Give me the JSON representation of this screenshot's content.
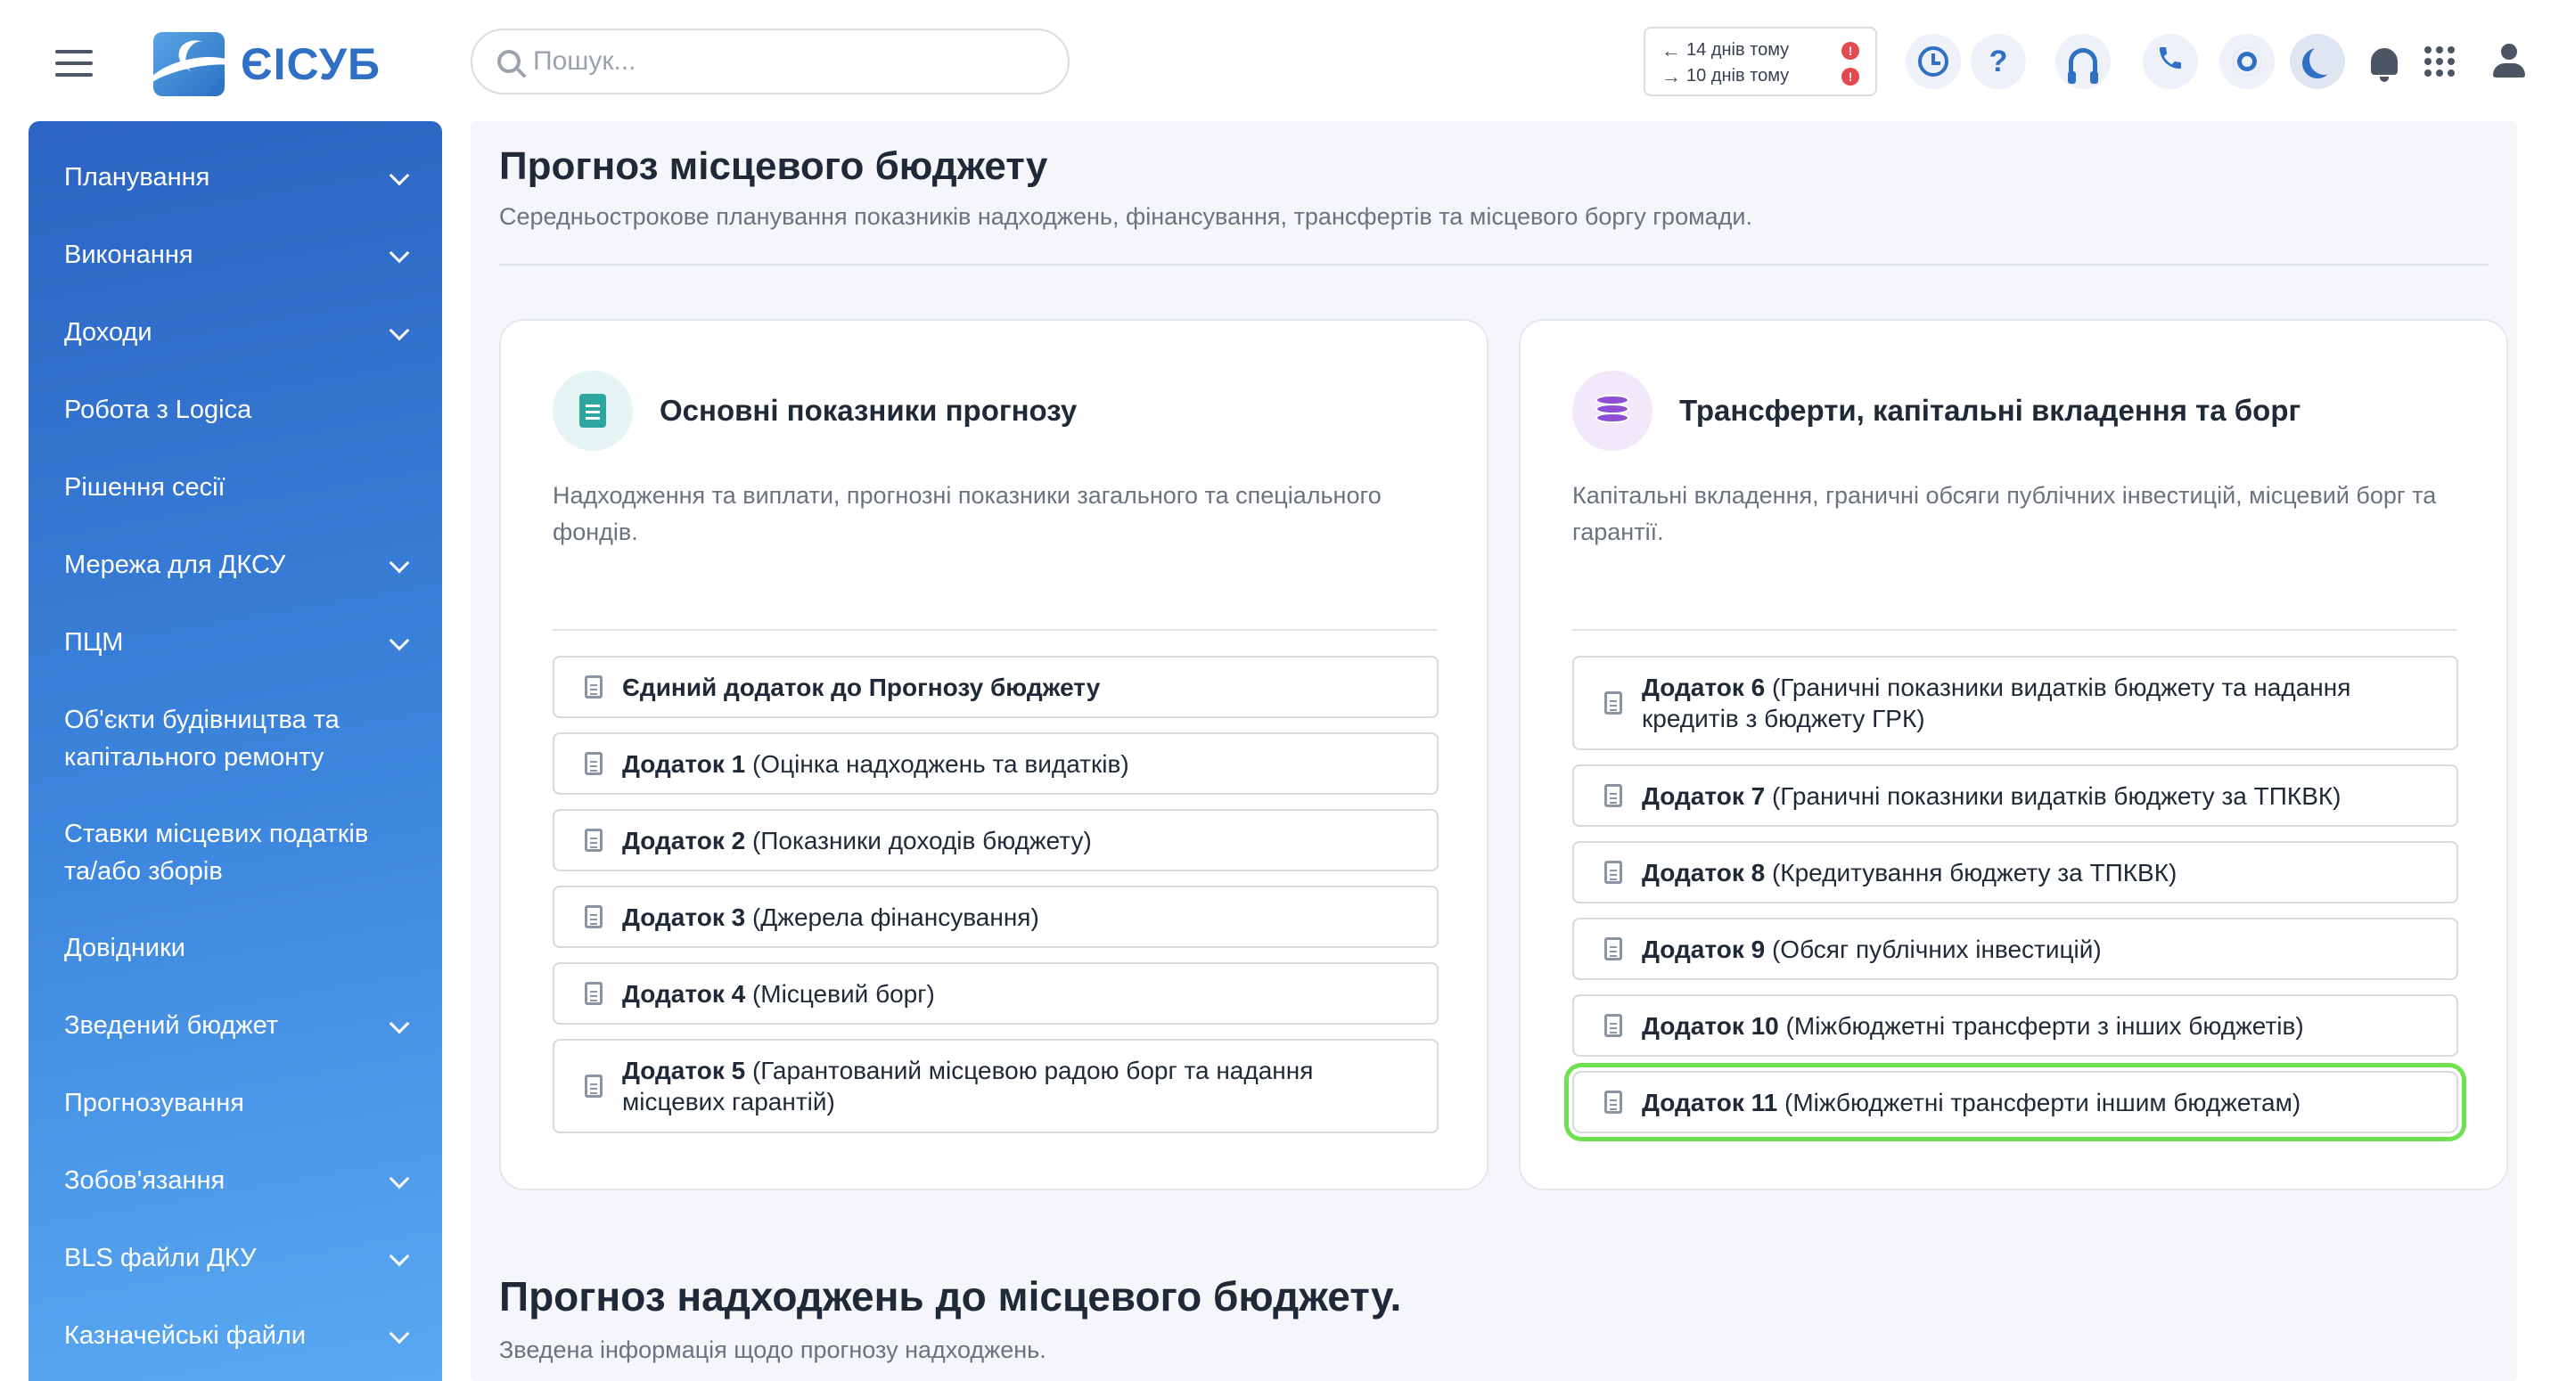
{
  "app": {
    "logo_text": "ЄІСУБ"
  },
  "search": {
    "placeholder": "Пошук..."
  },
  "history": [
    {
      "direction": "back",
      "label": "14 днів тому",
      "badge": "!"
    },
    {
      "direction": "forward",
      "label": "10 днів тому",
      "badge": "!"
    }
  ],
  "toolbar": {
    "help_label": "?",
    "icons": [
      "alarm-clock-icon",
      "help-icon",
      "headset-icon",
      "phone-icon",
      "gear-icon",
      "moon-icon",
      "bell-icon",
      "apps-grid-icon",
      "user-icon"
    ]
  },
  "sidebar": {
    "items": [
      {
        "label": "Планування",
        "expandable": true
      },
      {
        "label": "Виконання",
        "expandable": true
      },
      {
        "label": "Доходи",
        "expandable": true
      },
      {
        "label": "Робота з Logica",
        "expandable": false
      },
      {
        "label": "Рішення сесії",
        "expandable": false
      },
      {
        "label": "Мережа для ДКСУ",
        "expandable": true
      },
      {
        "label": "ПЦМ",
        "expandable": true
      },
      {
        "label": "Об'єкти будівництва та капітального ремонту",
        "expandable": false
      },
      {
        "label": "Ставки місцевих податків та/або зборів",
        "expandable": false
      },
      {
        "label": "Довідники",
        "expandable": false
      },
      {
        "label": "Зведений бюджет",
        "expandable": true
      },
      {
        "label": "Прогнозування",
        "expandable": false
      },
      {
        "label": "Зобов'язання",
        "expandable": true
      },
      {
        "label": "BLS файли ДКУ",
        "expandable": true
      },
      {
        "label": "Казначейські файли",
        "expandable": true
      }
    ]
  },
  "main": {
    "title": "Прогноз місцевого бюджету",
    "subtitle": "Середньострокове планування показників надходжень, фінансування, трансфертів та місцевого боргу громади.",
    "cards": [
      {
        "title": "Основні показники прогнозу",
        "icon": "document-icon",
        "description": "Надходження та виплати, прогнозні показники загального та спеціального фондів.",
        "documents": [
          {
            "label": "Єдиний додаток до Прогнозу бюджету"
          },
          {
            "label": "Додаток 1 (Оцінка надходжень та видатків)"
          },
          {
            "label": "Додаток 2 (Показники доходів бюджету)"
          },
          {
            "label": "Додаток 3 (Джерела фінансування)"
          },
          {
            "label": "Додаток 4 (Місцевий борг)"
          },
          {
            "label": "Додаток 5 (Гарантований місцевою радою борг та надання місцевих гарантій)"
          }
        ]
      },
      {
        "title": "Трансферти, капітальні вкладення та борг",
        "icon": "coins-icon",
        "description": "Капітальні вкладення, граничні обсяги публічних інвестицій, місцевий борг та гарантії.",
        "documents": [
          {
            "label": "Додаток 6 (Граничні показники видатків бюджету та надання кредитів з бюджету ГРК)"
          },
          {
            "label": "Додаток 7 (Граничні показники видатків бюджету за ТПКВК)"
          },
          {
            "label": "Додаток 8 (Кредитування бюджету за ТПКВК)"
          },
          {
            "label": "Додаток 9 (Обсяг публічних інвестицій)"
          },
          {
            "label": "Додаток 10 (Міжбюджетні трансферти з інших бюджетів)"
          },
          {
            "label": "Додаток 11 (Міжбюджетні трансферти іншим бюджетам)",
            "highlighted": true
          }
        ]
      }
    ],
    "section2": {
      "title": "Прогноз надходжень до місцевого бюджету.",
      "subtitle": "Зведена інформація щодо прогнозу надходжень."
    }
  },
  "colors": {
    "accent": "#2f6fc4",
    "highlight": "#6fe04f",
    "sidebar_top": "#2b64c2",
    "sidebar_bottom": "#5aa8f2"
  }
}
